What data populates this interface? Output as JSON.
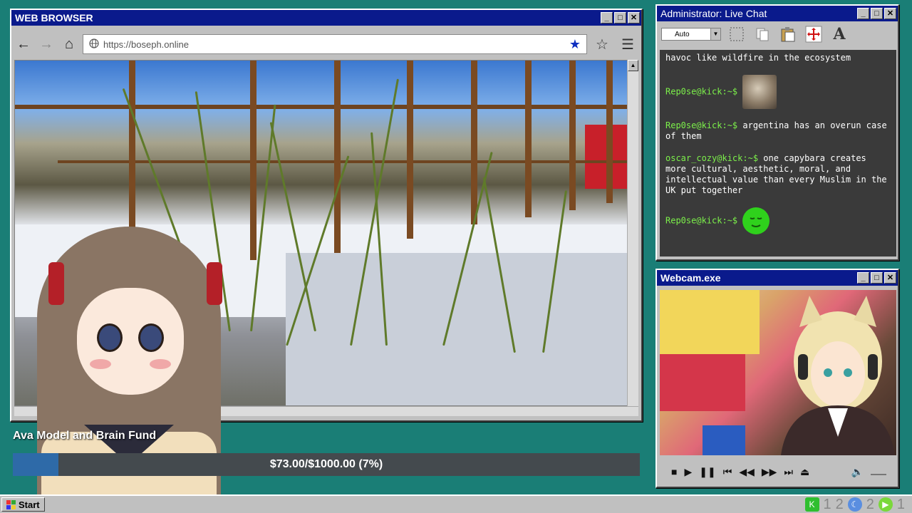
{
  "browser": {
    "title": "WEB BROWSER",
    "url": "https://boseph.online",
    "nav": {
      "back": "←",
      "forward": "→",
      "home": "⌂"
    },
    "controls": {
      "minimize": "_",
      "maximize": "□",
      "close": "✕"
    }
  },
  "chat": {
    "title": "Administrator: Live Chat",
    "select_value": "Auto",
    "messages": [
      {
        "user": "",
        "text": "havoc like wildfire in the ecosystem"
      },
      {
        "user": "Rep0se@kick:~$",
        "text": "",
        "emote": "capybara-emote"
      },
      {
        "user": "Rep0se@kick:~$",
        "text": " argentina has an overun case of them"
      },
      {
        "user": "oscar_cozy@kick:~$",
        "text": " one capybara creates more cultural, aesthetic, moral, and intellectual value than every Muslim in the UK put together"
      },
      {
        "user": "Rep0se@kick:~$",
        "text": "",
        "emote": "green-smiley-emote"
      }
    ],
    "controls": {
      "minimize": "_",
      "maximize": "□",
      "close": "✕"
    }
  },
  "webcam": {
    "title": "Webcam.exe",
    "controls": {
      "minimize": "_",
      "maximize": "□",
      "close": "✕"
    }
  },
  "fund": {
    "title": "Ava Model and Brain Fund",
    "progress_text": "$73.00/$1000.00 (7%)",
    "progress_fraction": 0.073
  },
  "taskbar": {
    "start_label": "Start",
    "tray": [
      "1",
      "2",
      "2",
      "1"
    ]
  },
  "colors": {
    "titlebar": "#0a1a8c",
    "desktop": "#1a7e76",
    "chat_user": "#7cf04a",
    "fund_fill": "#2e6aa8"
  }
}
